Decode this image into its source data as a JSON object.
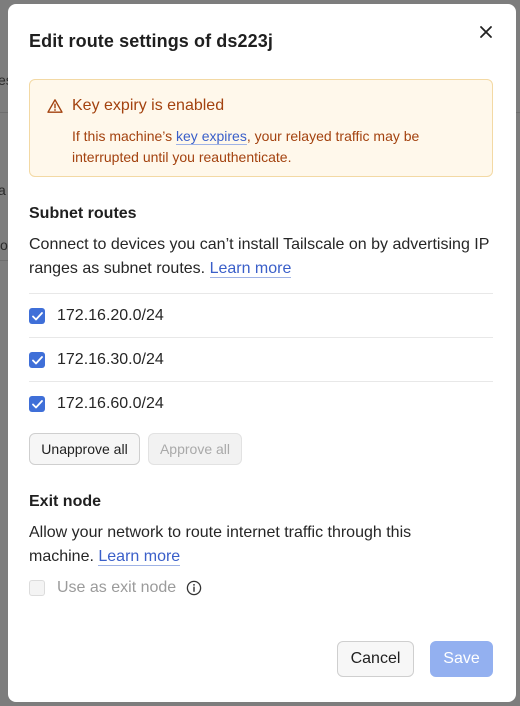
{
  "background_fragments": [
    "es",
    "a",
    "o"
  ],
  "dialog": {
    "title": "Edit route settings of ds223j",
    "close_icon": "close-icon"
  },
  "alert": {
    "icon": "warning-triangle-icon",
    "title": "Key expiry is enabled",
    "body_prefix": "If this machine’s ",
    "body_link": "key expires",
    "body_suffix": ", your relayed traffic may be interrupted until you reauthenticate.",
    "color": "#a3420f",
    "background": "#fff8eb"
  },
  "subnet": {
    "title": "Subnet routes",
    "description": "Connect to devices you can’t install Tailscale on by advertising IP ranges as subnet routes. ",
    "learn_more": "Learn more",
    "routes": [
      {
        "label": "172.16.20.0/24",
        "checked": true
      },
      {
        "label": "172.16.30.0/24",
        "checked": true
      },
      {
        "label": "172.16.60.0/24",
        "checked": true
      }
    ],
    "unapprove_all": "Unapprove all",
    "approve_all": "Approve all"
  },
  "exit_node": {
    "title": "Exit node",
    "description": "Allow your network to route internet traffic through this machine. ",
    "learn_more": "Learn more",
    "option_label": "Use as exit node",
    "option_checked": false,
    "option_disabled": true,
    "info_icon": "info-icon"
  },
  "footer": {
    "cancel": "Cancel",
    "save": "Save",
    "accent": "#3f6fd8"
  }
}
